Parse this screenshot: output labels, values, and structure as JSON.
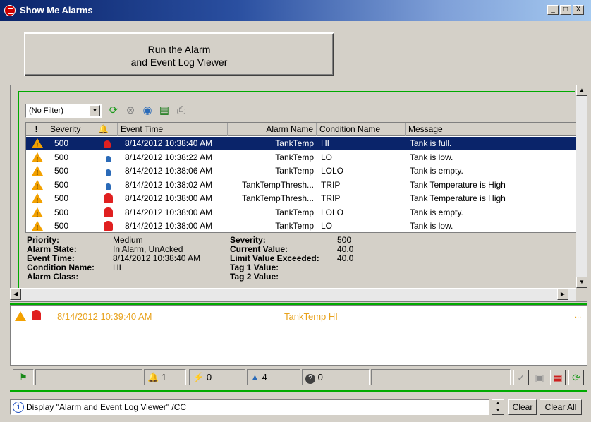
{
  "window": {
    "title": "Show Me Alarms",
    "controls": [
      "_",
      "□",
      "X"
    ]
  },
  "run_button": {
    "line1": "Run the Alarm",
    "line2": "and Event Log Viewer"
  },
  "toolbar": {
    "filter_value": "(No Filter)",
    "icons": [
      "refresh-icon",
      "stop-icon",
      "sound-icon",
      "details-icon",
      "print-icon"
    ]
  },
  "grid": {
    "columns": [
      "!",
      "Severity",
      "🔔",
      "Event Time",
      "Alarm Name",
      "Condition Name",
      "Message"
    ],
    "rows": [
      {
        "severity": "500",
        "bell": "red-small",
        "time": "8/14/2012 10:38:40 AM",
        "alarm": "TankTemp",
        "condition": "HI",
        "message": "Tank is full.",
        "selected": true
      },
      {
        "severity": "500",
        "bell": "blue",
        "time": "8/14/2012 10:38:22 AM",
        "alarm": "TankTemp",
        "condition": "LO",
        "message": "Tank is low.",
        "selected": false
      },
      {
        "severity": "500",
        "bell": "blue",
        "time": "8/14/2012 10:38:06 AM",
        "alarm": "TankTemp",
        "condition": "LOLO",
        "message": "Tank is empty.",
        "selected": false
      },
      {
        "severity": "500",
        "bell": "blue",
        "time": "8/14/2012 10:38:02 AM",
        "alarm": "TankTempThresh...",
        "condition": "TRIP",
        "message": "Tank Temperature is High",
        "selected": false
      },
      {
        "severity": "500",
        "bell": "red",
        "time": "8/14/2012 10:38:00 AM",
        "alarm": "TankTempThresh...",
        "condition": "TRIP",
        "message": "Tank Temperature is High",
        "selected": false
      },
      {
        "severity": "500",
        "bell": "red",
        "time": "8/14/2012 10:38:00 AM",
        "alarm": "TankTemp",
        "condition": "LOLO",
        "message": "Tank is empty.",
        "selected": false
      },
      {
        "severity": "500",
        "bell": "red",
        "time": "8/14/2012 10:38:00 AM",
        "alarm": "TankTemp",
        "condition": "LO",
        "message": "Tank is low.",
        "selected": false
      }
    ]
  },
  "details": {
    "priority_label": "Priority:",
    "priority": "Medium",
    "state_label": "Alarm State:",
    "state": "In Alarm, UnAcked",
    "time_label": "Event Time:",
    "time": "8/14/2012 10:38:40 AM",
    "cond_label": "Condition Name:",
    "cond": "HI",
    "class_label": "Alarm Class:",
    "severity_label": "Severity:",
    "severity": "500",
    "current_label": "Current Value:",
    "current": "40.0",
    "limit_label": "Limit Value Exceeded:",
    "limit": "40.0",
    "tag1_label": "Tag 1 Value:",
    "tag2_label": "Tag 2 Value:"
  },
  "banner": {
    "time": "8/14/2012 10:39:40 AM",
    "alarm": "TankTemp HI",
    "more": "..."
  },
  "status": {
    "red_count": "1",
    "disabled_count": "0",
    "blue_count": "4",
    "unknown_count": "0"
  },
  "command": {
    "text": "Display \"Alarm and Event Log Viewer\" /CC",
    "clear_label": "Clear",
    "clear_all_label": "Clear All"
  },
  "colors": {
    "selection": "#0a246a",
    "banner_text": "#e8a21c",
    "green_border": "#00aa00",
    "warning": "#f3a100"
  }
}
